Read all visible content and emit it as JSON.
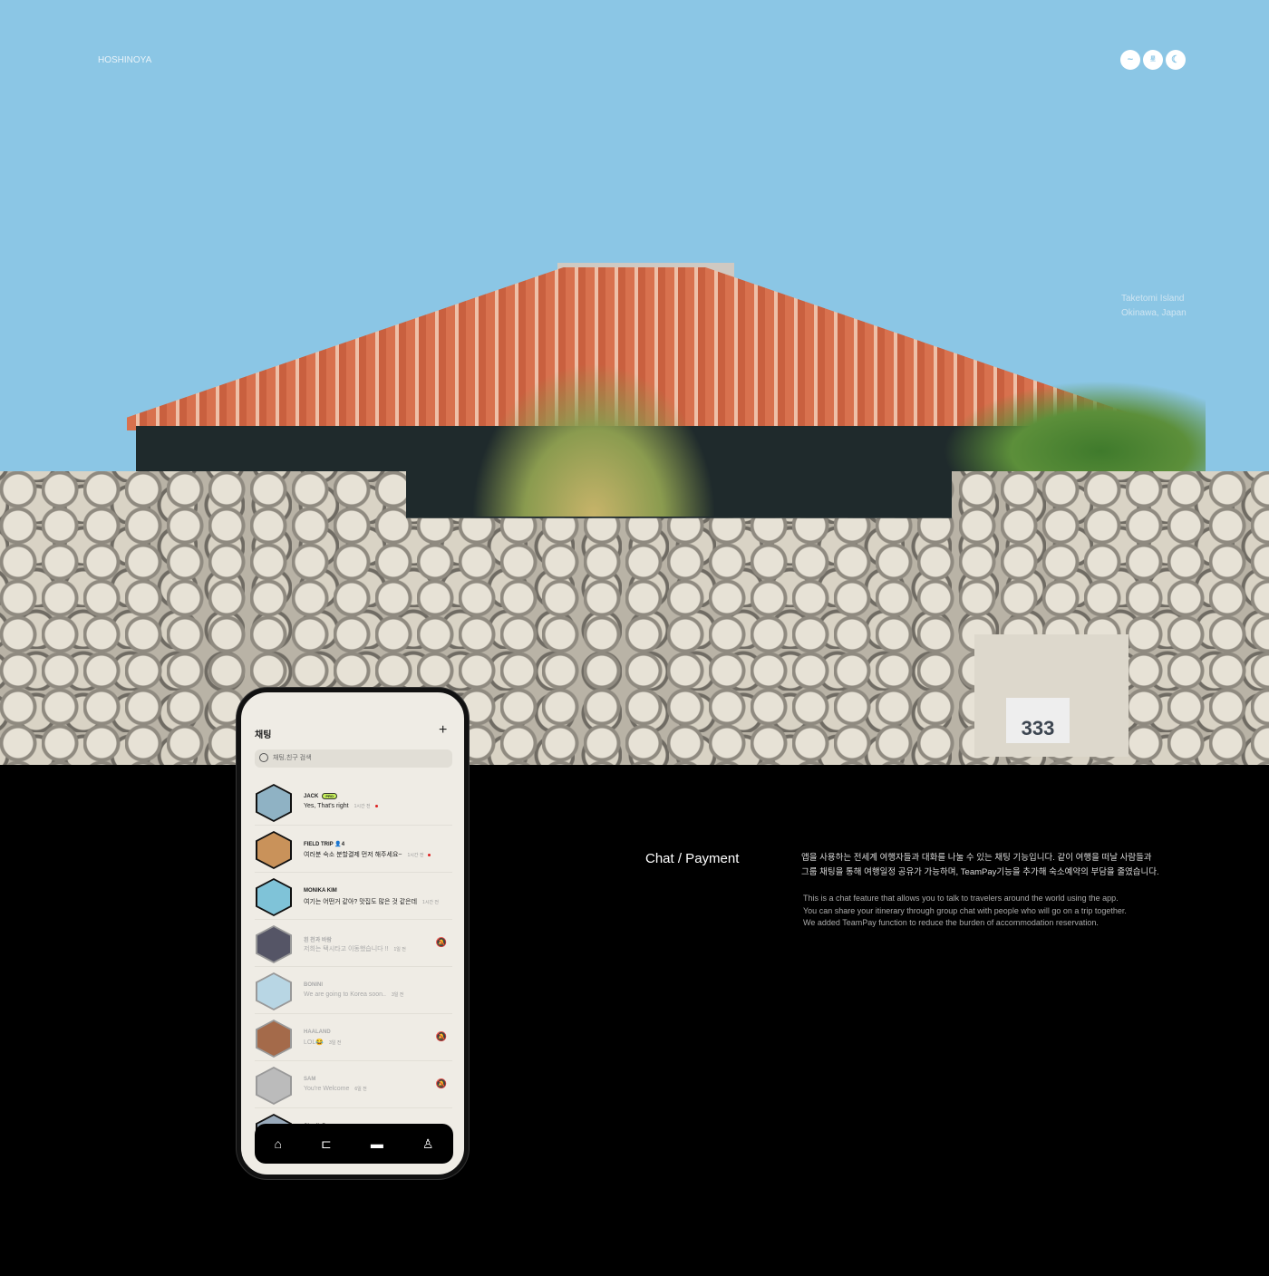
{
  "brand": "HOSHINOYA",
  "logo_marks": [
    "wave",
    "星のや",
    "moon"
  ],
  "location": {
    "line1": "Taketomi Island",
    "line2": "Okinawa, Japan"
  },
  "gate_number": "333",
  "phone": {
    "title": "채팅",
    "add": "+",
    "search_placeholder": "채팅,친구 검색",
    "chats": [
      {
        "name": "JACK",
        "badge": "PRO",
        "message": "Yes, That's right",
        "time": "1시간 전",
        "unread": true
      },
      {
        "name": "FIELD TRIP",
        "members": "4",
        "message": "여러분 숙소 분할결제 먼저 해주세요~",
        "time": "1시간 전",
        "unread": true
      },
      {
        "name": "MONIKA KIM",
        "message": "여기는 어떤거 같아? 맛집도 많은 것 같은데",
        "time": "1시간 전"
      },
      {
        "name": "흰 천과 바람",
        "message": "저희는 택시타고 이동했습니다 !!",
        "time": "1일 전",
        "muted": true
      },
      {
        "name": "BONINI",
        "message": "We are going to Korea soon..",
        "time": "3일 전"
      },
      {
        "name": "HAALAND",
        "message": "LOL😂",
        "time": "3일 전",
        "muted": true
      },
      {
        "name": "SAM",
        "message": "You're Welcome",
        "time": "6일 전",
        "muted": true
      },
      {
        "name": "CharlieP",
        "message": "",
        "time": ""
      }
    ],
    "nav": [
      "home-icon",
      "ticket-icon",
      "chat-icon",
      "profile-icon"
    ]
  },
  "section": {
    "title": "Chat / Payment",
    "ko_line1": "앱을 사용하는 전세계 여행자들과 대화를 나눌 수 있는  채팅 기능입니다. 같이 여행을 떠날 사람들과",
    "ko_line2": "그룹 채팅을 통해 여행일정 공유가 가능하며, TeamPay기능을 추가해 숙소예약의 부담을 줄였습니다.",
    "en_line1": "This is a chat feature that allows you to talk to travelers around the world using the app.",
    "en_line2": "You can share your itinerary through group chat with people who will go on a trip together.",
    "en_line3": "We added TeamPay function to reduce the burden of accommodation reservation."
  }
}
